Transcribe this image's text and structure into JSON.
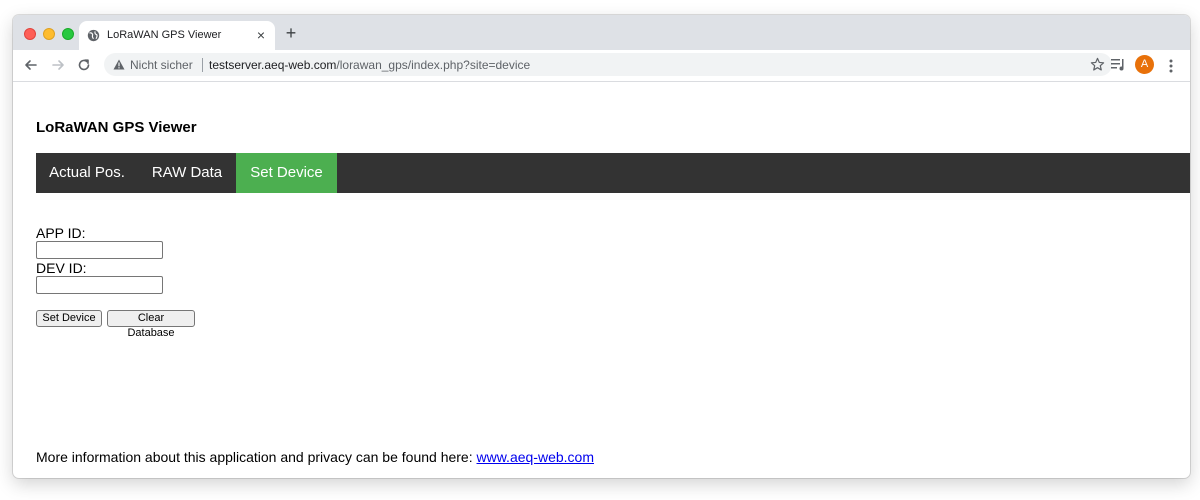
{
  "browser": {
    "tab_title": "LoRaWAN GPS Viewer",
    "tab_close": "×",
    "new_tab": "+",
    "security_label": "Nicht sicher",
    "url_host": "testserver.aeq-web.com",
    "url_path": "/lorawan_gps/index.php?site=device",
    "avatar_initial": "A",
    "icons": [
      "globe-icon",
      "back-icon",
      "forward-icon",
      "reload-icon",
      "warning-icon",
      "star-icon",
      "media-control-icon",
      "menu-icon"
    ]
  },
  "page": {
    "title": "LoRaWAN GPS Viewer",
    "nav": {
      "items": [
        "Actual Pos.",
        "RAW Data",
        "Set Device"
      ],
      "active": "Set Device",
      "bg_color": "#333333",
      "active_color": "#4caf50"
    },
    "form": {
      "app_id_label": "APP ID:",
      "app_id_value": "",
      "dev_id_label": "DEV ID:",
      "dev_id_value": "",
      "set_device_button": "Set Device",
      "clear_db_button": "Clear Database"
    },
    "footer": {
      "text": "More information about this application and privacy can be found here: ",
      "link_text": "www.aeq-web.com"
    }
  }
}
